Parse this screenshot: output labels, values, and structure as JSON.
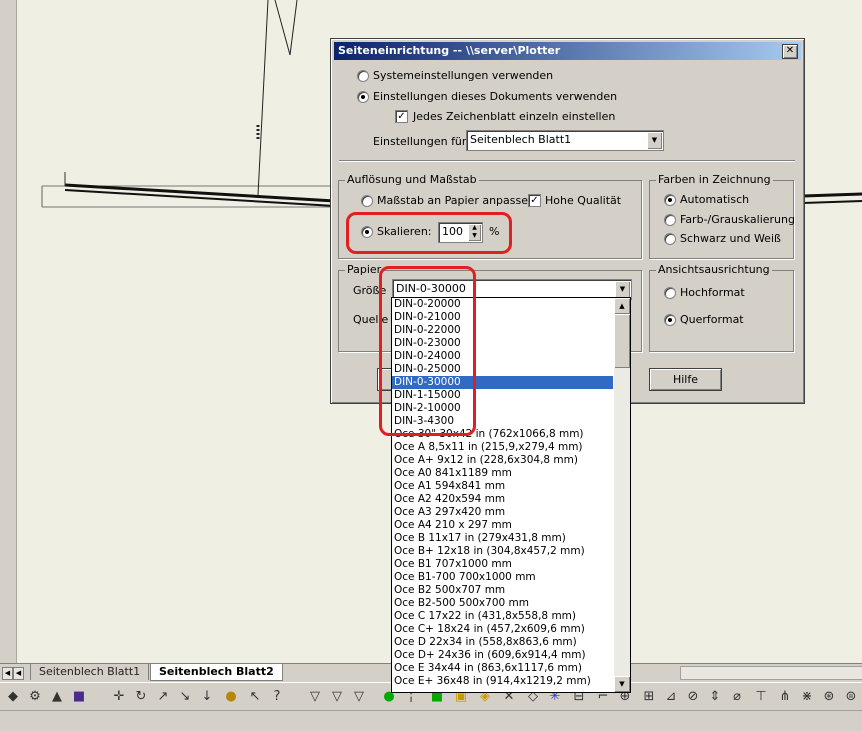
{
  "dialog": {
    "title": "Seiteneinrichtung -- \\\\server\\Plotter",
    "close_glyph": "✕",
    "radio_system": "Systemeinstellungen verwenden",
    "radio_document": "Einstellungen dieses Dokuments verwenden",
    "check_each_sheet": "Jedes Zeichenblatt einzeln einstellen",
    "settings_for_label": "Einstellungen für:",
    "settings_for_value": "Seitenblech Blatt1",
    "resolution_group": {
      "title": "Auflösung und Maßstab",
      "fit_scale": "Maßstab an Papier anpassen",
      "high_quality": "Hohe Qualität",
      "scale_label": "Skalieren:",
      "scale_value": "100",
      "percent": "%"
    },
    "colors_group": {
      "title": "Farben in Zeichnung",
      "auto": "Automatisch",
      "color_gray": "Farb-/Grauskalierung",
      "black_white": "Schwarz und Weiß"
    },
    "paper_group": {
      "title": "Papier",
      "size_label": "Größe",
      "size_value": "DIN-0-30000",
      "source_label": "Quelle"
    },
    "orientation_group": {
      "title": "Ansichtsausrichtung",
      "portrait": "Hochformat",
      "landscape": "Querformat"
    },
    "help_button": "Hilfe"
  },
  "dropdown": {
    "selected": "DIN-0-30000",
    "items": [
      "DIN-0-20000",
      "DIN-0-21000",
      "DIN-0-22000",
      "DIN-0-23000",
      "DIN-0-24000",
      "DIN-0-25000",
      "DIN-0-30000",
      "DIN-1-15000",
      "DIN-2-10000",
      "DIN-3-4300",
      "Oce 30\" 30x42 in (762x1066,8 mm)",
      "Oce A 8,5x11 in (215,9,x279,4 mm)",
      "Oce A+ 9x12 in (228,6x304,8 mm)",
      "Oce A0 841x1189 mm",
      "Oce A1 594x841 mm",
      "Oce A2 420x594 mm",
      "Oce A3 297x420 mm",
      "Oce A4 210 x 297 mm",
      "Oce B 11x17 in (279x431,8 mm)",
      "Oce B+ 12x18 in (304,8x457,2 mm)",
      "Oce B1 707x1000 mm",
      "Oce B1-700 700x1000 mm",
      "Oce B2 500x707 mm",
      "Oce B2-500 500x700 mm",
      "Oce C 17x22 in (431,8x558,8 mm)",
      "Oce C+ 18x24 in (457,2x609,6 mm)",
      "Oce D 22x34 in (558,8x863,6 mm)",
      "Oce D+ 24x36 in (609,6x914,4 mm)",
      "Oce E 34x44 in (863,6x1117,6 mm)",
      "Oce E+ 36x48 in (914,4x1219,2 mm)"
    ]
  },
  "sheet_tabs": [
    "Seitenblech Blatt1",
    "Seitenblech Blatt2"
  ],
  "colors": {
    "title_start": "#0a246a",
    "title_end": "#a6caf0",
    "highlight": "#316ac5",
    "callout": "#e02020"
  }
}
